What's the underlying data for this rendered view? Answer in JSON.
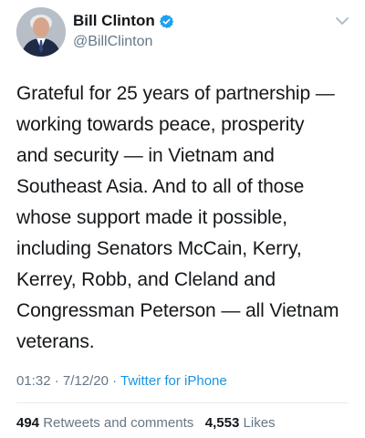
{
  "author": {
    "name": "Bill Clinton",
    "handle": "@BillClinton",
    "verified": true,
    "verified_color": "#1da1f2"
  },
  "tweet": {
    "text": "Grateful for 25 years of partnership —\nworking towards peace, prosperity\nand security — in Vietnam and\nSoutheast Asia. And to all of those\nwhose support made it possible,\nincluding Senators McCain, Kerry,\nKerrey, Robb, and Cleland and\nCongressman Peterson — all Vietnam\nveterans."
  },
  "meta": {
    "time": "01:32",
    "separator": "·",
    "date": "7/12/20",
    "source": "Twitter for iPhone"
  },
  "stats": {
    "retweets_count": "494",
    "retweets_label": "Retweets and comments",
    "likes_count": "4,553",
    "likes_label": "Likes"
  },
  "colors": {
    "link": "#1b95e0",
    "secondary_text": "#657786",
    "primary_text": "#14171a",
    "divider": "#e6ecf0"
  },
  "icons": {
    "verified": "verified-badge-icon",
    "menu": "chevron-down-icon"
  }
}
